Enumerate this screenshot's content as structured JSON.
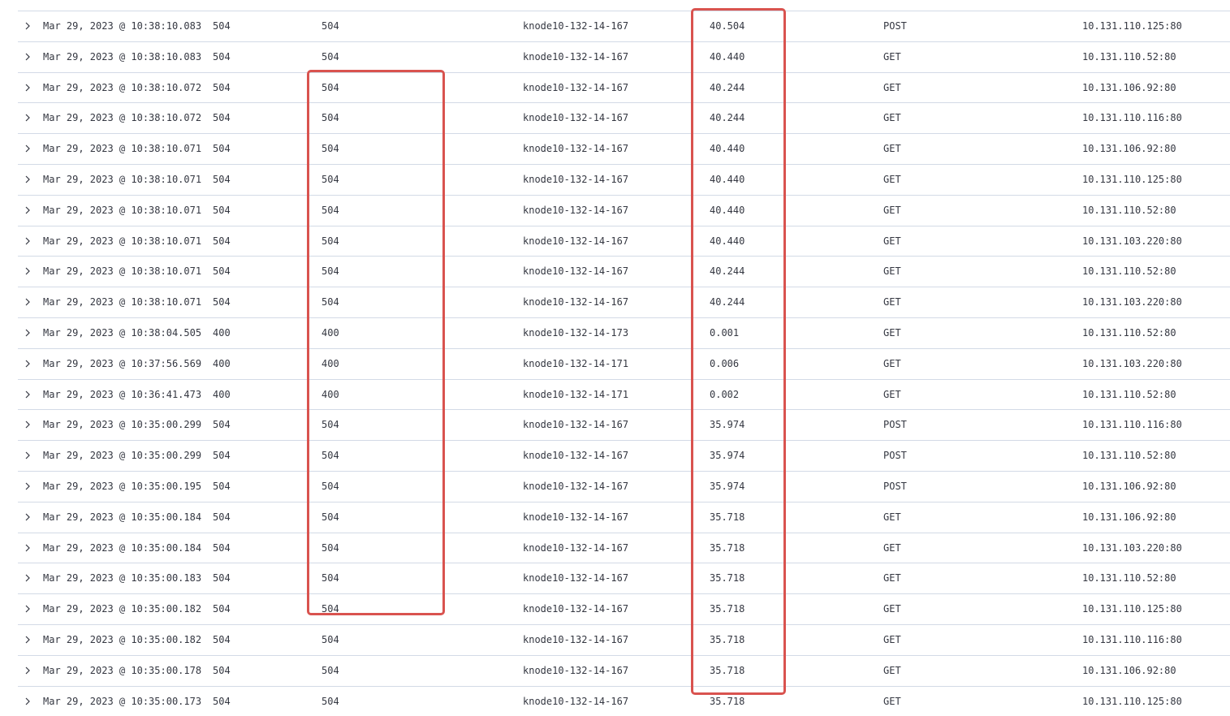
{
  "rows": [
    {
      "time": "Mar 29, 2023 @ 10:38:10.083",
      "status": "504",
      "upstream_status": "504",
      "host": "knode10-132-14-167",
      "response_time": "40.504",
      "method": "POST",
      "upstream": "10.131.110.125:80"
    },
    {
      "time": "Mar 29, 2023 @ 10:38:10.083",
      "status": "504",
      "upstream_status": "504",
      "host": "knode10-132-14-167",
      "response_time": "40.440",
      "method": "GET",
      "upstream": "10.131.110.52:80"
    },
    {
      "time": "Mar 29, 2023 @ 10:38:10.072",
      "status": "504",
      "upstream_status": "504",
      "host": "knode10-132-14-167",
      "response_time": "40.244",
      "method": "GET",
      "upstream": "10.131.106.92:80"
    },
    {
      "time": "Mar 29, 2023 @ 10:38:10.072",
      "status": "504",
      "upstream_status": "504",
      "host": "knode10-132-14-167",
      "response_time": "40.244",
      "method": "GET",
      "upstream": "10.131.110.116:80"
    },
    {
      "time": "Mar 29, 2023 @ 10:38:10.071",
      "status": "504",
      "upstream_status": "504",
      "host": "knode10-132-14-167",
      "response_time": "40.440",
      "method": "GET",
      "upstream": "10.131.106.92:80"
    },
    {
      "time": "Mar 29, 2023 @ 10:38:10.071",
      "status": "504",
      "upstream_status": "504",
      "host": "knode10-132-14-167",
      "response_time": "40.440",
      "method": "GET",
      "upstream": "10.131.110.125:80"
    },
    {
      "time": "Mar 29, 2023 @ 10:38:10.071",
      "status": "504",
      "upstream_status": "504",
      "host": "knode10-132-14-167",
      "response_time": "40.440",
      "method": "GET",
      "upstream": "10.131.110.52:80"
    },
    {
      "time": "Mar 29, 2023 @ 10:38:10.071",
      "status": "504",
      "upstream_status": "504",
      "host": "knode10-132-14-167",
      "response_time": "40.440",
      "method": "GET",
      "upstream": "10.131.103.220:80"
    },
    {
      "time": "Mar 29, 2023 @ 10:38:10.071",
      "status": "504",
      "upstream_status": "504",
      "host": "knode10-132-14-167",
      "response_time": "40.244",
      "method": "GET",
      "upstream": "10.131.110.52:80"
    },
    {
      "time": "Mar 29, 2023 @ 10:38:10.071",
      "status": "504",
      "upstream_status": "504",
      "host": "knode10-132-14-167",
      "response_time": "40.244",
      "method": "GET",
      "upstream": "10.131.103.220:80"
    },
    {
      "time": "Mar 29, 2023 @ 10:38:04.505",
      "status": "400",
      "upstream_status": "400",
      "host": "knode10-132-14-173",
      "response_time": "0.001",
      "method": "GET",
      "upstream": "10.131.110.52:80"
    },
    {
      "time": "Mar 29, 2023 @ 10:37:56.569",
      "status": "400",
      "upstream_status": "400",
      "host": "knode10-132-14-171",
      "response_time": "0.006",
      "method": "GET",
      "upstream": "10.131.103.220:80"
    },
    {
      "time": "Mar 29, 2023 @ 10:36:41.473",
      "status": "400",
      "upstream_status": "400",
      "host": "knode10-132-14-171",
      "response_time": "0.002",
      "method": "GET",
      "upstream": "10.131.110.52:80"
    },
    {
      "time": "Mar 29, 2023 @ 10:35:00.299",
      "status": "504",
      "upstream_status": "504",
      "host": "knode10-132-14-167",
      "response_time": "35.974",
      "method": "POST",
      "upstream": "10.131.110.116:80"
    },
    {
      "time": "Mar 29, 2023 @ 10:35:00.299",
      "status": "504",
      "upstream_status": "504",
      "host": "knode10-132-14-167",
      "response_time": "35.974",
      "method": "POST",
      "upstream": "10.131.110.52:80"
    },
    {
      "time": "Mar 29, 2023 @ 10:35:00.195",
      "status": "504",
      "upstream_status": "504",
      "host": "knode10-132-14-167",
      "response_time": "35.974",
      "method": "POST",
      "upstream": "10.131.106.92:80"
    },
    {
      "time": "Mar 29, 2023 @ 10:35:00.184",
      "status": "504",
      "upstream_status": "504",
      "host": "knode10-132-14-167",
      "response_time": "35.718",
      "method": "GET",
      "upstream": "10.131.106.92:80"
    },
    {
      "time": "Mar 29, 2023 @ 10:35:00.184",
      "status": "504",
      "upstream_status": "504",
      "host": "knode10-132-14-167",
      "response_time": "35.718",
      "method": "GET",
      "upstream": "10.131.103.220:80"
    },
    {
      "time": "Mar 29, 2023 @ 10:35:00.183",
      "status": "504",
      "upstream_status": "504",
      "host": "knode10-132-14-167",
      "response_time": "35.718",
      "method": "GET",
      "upstream": "10.131.110.52:80"
    },
    {
      "time": "Mar 29, 2023 @ 10:35:00.182",
      "status": "504",
      "upstream_status": "504",
      "host": "knode10-132-14-167",
      "response_time": "35.718",
      "method": "GET",
      "upstream": "10.131.110.125:80"
    },
    {
      "time": "Mar 29, 2023 @ 10:35:00.182",
      "status": "504",
      "upstream_status": "504",
      "host": "knode10-132-14-167",
      "response_time": "35.718",
      "method": "GET",
      "upstream": "10.131.110.116:80"
    },
    {
      "time": "Mar 29, 2023 @ 10:35:00.178",
      "status": "504",
      "upstream_status": "504",
      "host": "knode10-132-14-167",
      "response_time": "35.718",
      "method": "GET",
      "upstream": "10.131.106.92:80"
    },
    {
      "time": "Mar 29, 2023 @ 10:35:00.173",
      "status": "504",
      "upstream_status": "504",
      "host": "knode10-132-14-167",
      "response_time": "35.718",
      "method": "GET",
      "upstream": "10.131.110.125:80"
    }
  ],
  "icons": {
    "row_expand": "chevron-right-icon"
  },
  "colors": {
    "highlight": "#d9534f",
    "text": "#343741",
    "row_border": "#d3dae6"
  }
}
